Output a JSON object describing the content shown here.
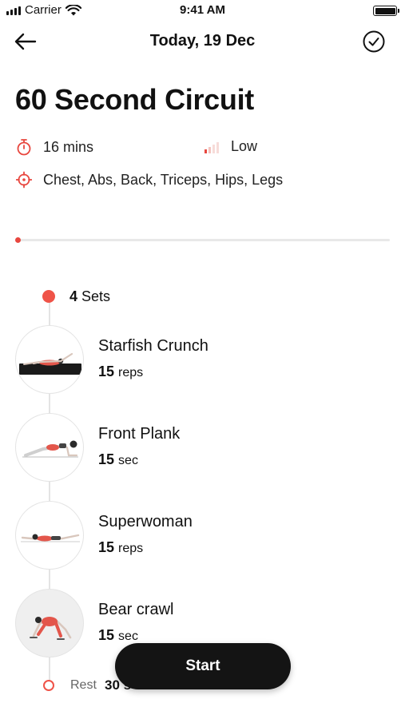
{
  "status_bar": {
    "carrier": "Carrier",
    "time": "9:41 AM"
  },
  "nav": {
    "title": "Today, 19 Dec"
  },
  "workout": {
    "title": "60 Second Circuit",
    "duration": "16 mins",
    "intensity": "Low",
    "muscles": "Chest, Abs, Back, Triceps, Hips, Legs",
    "progress_percent": 0
  },
  "circuit": {
    "sets_count": "4",
    "sets_label": "Sets",
    "exercises": [
      {
        "name": "Starfish Crunch",
        "amount": "15",
        "unit": "reps"
      },
      {
        "name": "Front Plank",
        "amount": "15",
        "unit": "sec"
      },
      {
        "name": "Superwoman",
        "amount": "15",
        "unit": "reps"
      },
      {
        "name": "Bear crawl",
        "amount": "15",
        "unit": "sec"
      }
    ],
    "rest_label": "Rest",
    "rest_value": "30 s"
  },
  "actions": {
    "start_label": "Start"
  },
  "colors": {
    "accent": "#ef5348",
    "button": "#141414"
  },
  "icons": [
    "back-arrow-icon",
    "checkmark-circle-icon",
    "stopwatch-icon",
    "signal-bars-icon",
    "target-icon",
    "wifi-icon",
    "battery-icon"
  ]
}
